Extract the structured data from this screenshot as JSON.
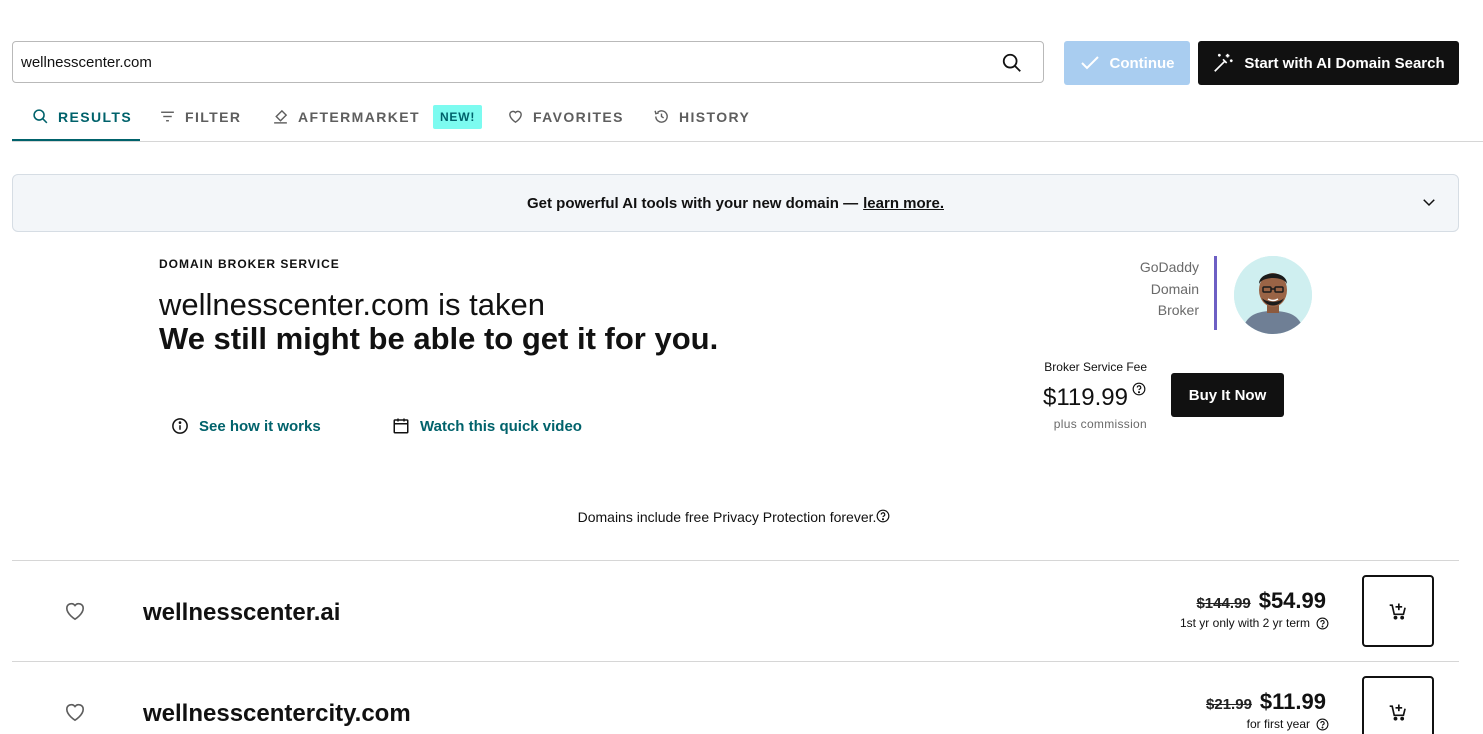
{
  "search": {
    "value": "wellnesscenter.com",
    "icon": "search-icon"
  },
  "actions": {
    "continue_label": "Continue",
    "ai_label": "Start with AI Domain Search"
  },
  "tabs": [
    {
      "label": "RESULTS",
      "icon": "search-icon",
      "active": true
    },
    {
      "label": "FILTER",
      "icon": "filter-icon",
      "active": false
    },
    {
      "label": "AFTERMARKET",
      "icon": "gavel-icon",
      "badge": "NEW!",
      "active": false
    },
    {
      "label": "FAVORITES",
      "icon": "heart-icon",
      "active": false
    },
    {
      "label": "HISTORY",
      "icon": "history-icon",
      "active": false
    }
  ],
  "banner": {
    "text": "Get powerful AI tools with your new domain —",
    "link": "learn more."
  },
  "broker": {
    "kicker": "DOMAIN BROKER SERVICE",
    "title_line1": "wellnesscenter.com is taken",
    "title_line2": "We still might be able to get it for you.",
    "link_how": "See how it works",
    "link_video": "Watch this quick video",
    "label_line1": "GoDaddy",
    "label_line2": "Domain",
    "label_line3": "Broker",
    "fee_label": "Broker Service Fee",
    "fee_price": "$119.99",
    "fee_sub": "plus commission",
    "buy_label": "Buy It Now"
  },
  "privacy_note": "Domains include free Privacy Protection forever.",
  "results": [
    {
      "domain": "wellnesscenter.ai",
      "old_price": "$144.99",
      "price": "$54.99",
      "term": "1st yr only with 2 yr term"
    },
    {
      "domain": "wellnesscentercity.com",
      "old_price": "$21.99",
      "price": "$11.99",
      "term": "for first year"
    }
  ],
  "colors": {
    "accent": "#00626b",
    "continue_disabled": "#a9cdf0",
    "badge": "#7cfbf0",
    "broker_divider": "#6d5fc4"
  }
}
